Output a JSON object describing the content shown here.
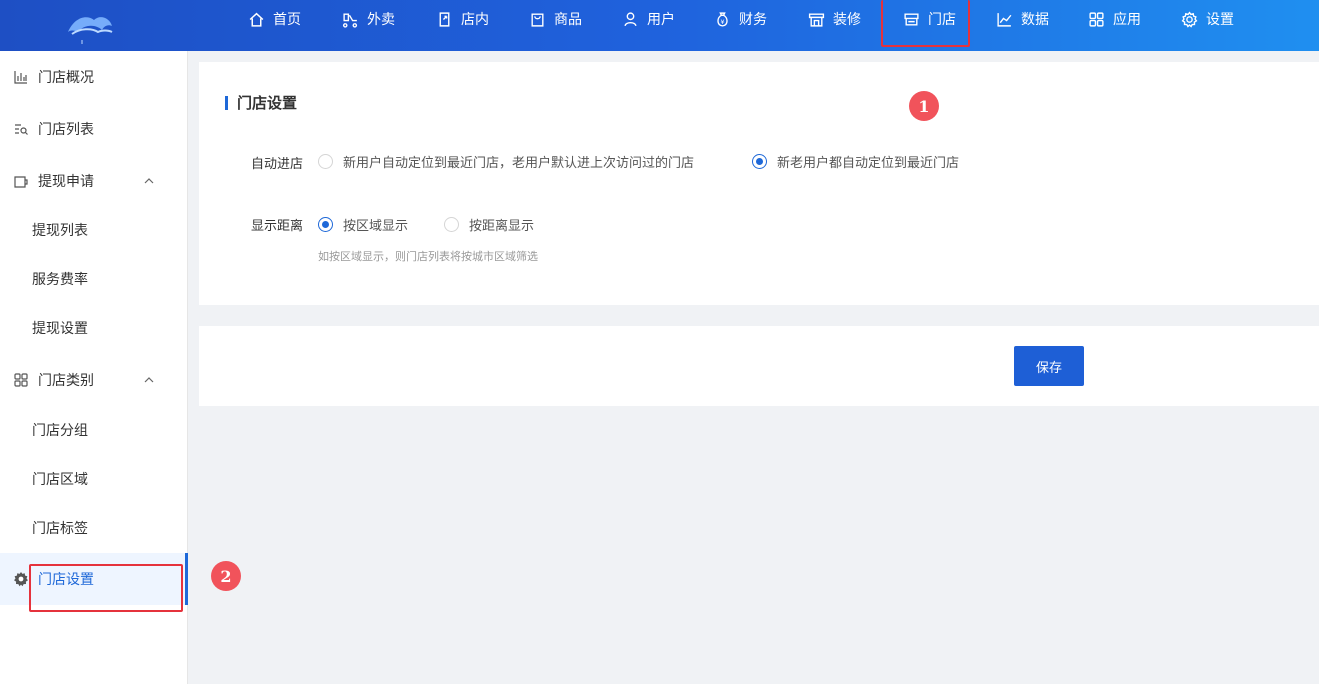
{
  "nav": {
    "items": [
      {
        "label": "首页",
        "icon": "home-icon"
      },
      {
        "label": "外卖",
        "icon": "scooter-icon"
      },
      {
        "label": "店内",
        "icon": "door-icon"
      },
      {
        "label": "商品",
        "icon": "bag-icon"
      },
      {
        "label": "用户",
        "icon": "user-icon"
      },
      {
        "label": "财务",
        "icon": "money-bag-icon"
      },
      {
        "label": "装修",
        "icon": "storefront-icon"
      },
      {
        "label": "门店",
        "icon": "store-icon"
      },
      {
        "label": "数据",
        "icon": "chart-line-icon"
      },
      {
        "label": "应用",
        "icon": "apps-icon"
      },
      {
        "label": "设置",
        "icon": "gear-icon"
      }
    ],
    "active": "门店"
  },
  "sidebar": {
    "items": [
      {
        "label": "门店概况",
        "icon": "bar-chart-icon"
      },
      {
        "label": "门店列表",
        "icon": "list-search-icon"
      },
      {
        "label": "提现申请",
        "icon": "wallet-icon",
        "expandable": true
      },
      {
        "label": "提现列表"
      },
      {
        "label": "服务费率"
      },
      {
        "label": "提现设置"
      },
      {
        "label": "门店类别",
        "icon": "grid-icon",
        "expandable": true
      },
      {
        "label": "门店分组"
      },
      {
        "label": "门店区域"
      },
      {
        "label": "门店标签"
      },
      {
        "label": "门店设置",
        "icon": "gear-icon",
        "active": true
      }
    ]
  },
  "main": {
    "title": "门店设置",
    "auto_enter": {
      "label": "自动进店",
      "options": [
        "新用户自动定位到最近门店，老用户默认进上次访问过的门店",
        "新老用户都自动定位到最近门店"
      ],
      "selected": 1
    },
    "distance": {
      "label": "显示距离",
      "options": [
        "按区域显示",
        "按距离显示"
      ],
      "selected": 0,
      "hint": "如按区域显示，则门店列表将按城市区域筛选"
    },
    "save_label": "保存"
  },
  "annotations": [
    "1",
    "2"
  ],
  "colors": {
    "accent": "#1e68d8",
    "highlight": "#e5323c",
    "badge": "#f1535b"
  }
}
